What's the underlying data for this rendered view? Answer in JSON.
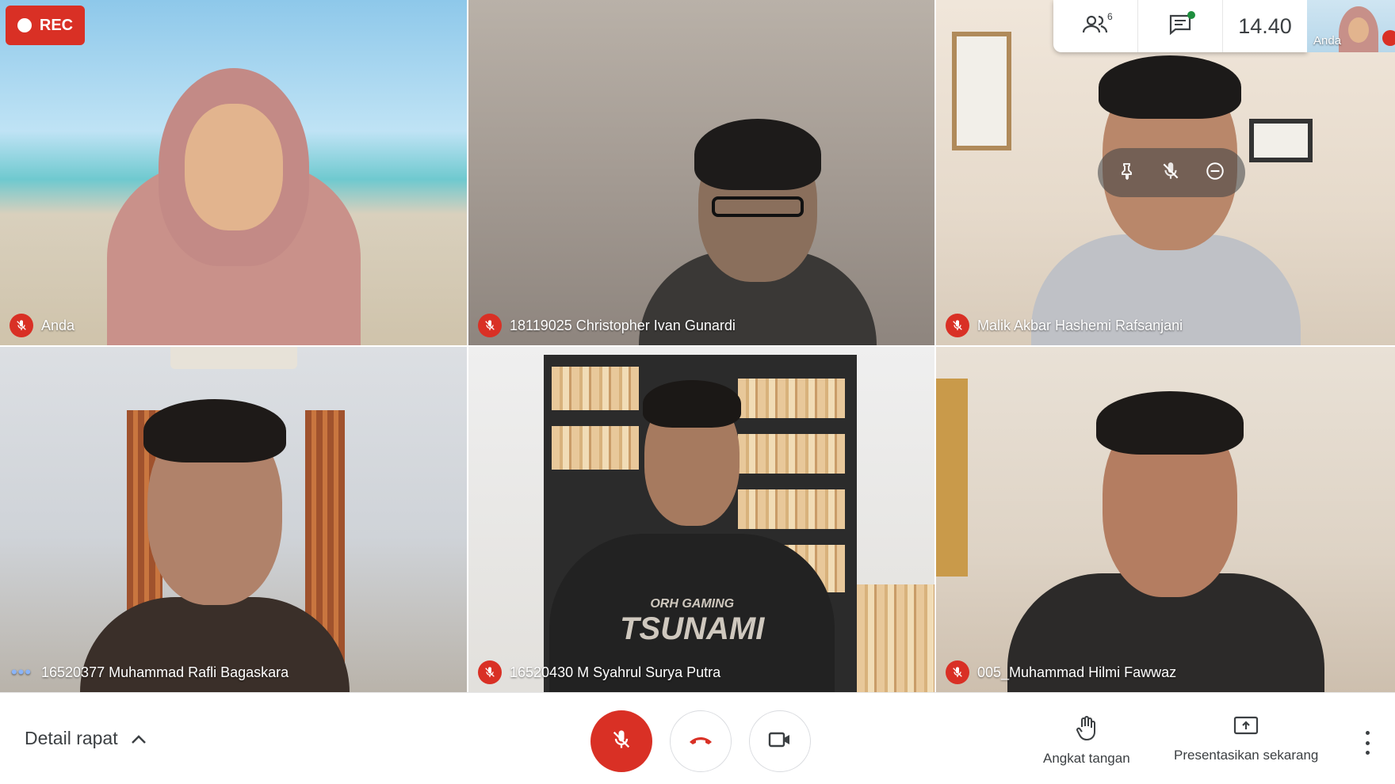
{
  "recording": {
    "label": "REC"
  },
  "topbar": {
    "participants_icon": "people-icon",
    "participants_count": "6",
    "chat_icon": "chat-icon",
    "time": "14.40",
    "self_view_label": "Anda"
  },
  "tiles": [
    {
      "name": "Anda",
      "status": "muted"
    },
    {
      "name": "18119025 Christopher Ivan Gunardi",
      "status": "muted"
    },
    {
      "name": "Malik Akbar Hashemi Rafsanjani",
      "status": "muted"
    },
    {
      "name": "16520377 Muhammad Rafli Bagaskara",
      "status": "speaking"
    },
    {
      "name": "16520430 M Syahrul Surya Putra",
      "status": "muted"
    },
    {
      "name": "005_Muhammad Hilmi Fawwaz",
      "status": "muted"
    }
  ],
  "tile_shirt_text": [
    "ORH GAMING",
    "TSUNAMI"
  ],
  "hover_controls": [
    "pin-icon",
    "mute-icon",
    "remove-icon"
  ],
  "bottombar": {
    "details_label": "Detail rapat",
    "raise_hand_label": "Angkat tangan",
    "present_label": "Presentasikan sekarang"
  },
  "colors": {
    "red": "#d93025",
    "text": "#3c4043",
    "speaking": "#8ab4f8"
  }
}
